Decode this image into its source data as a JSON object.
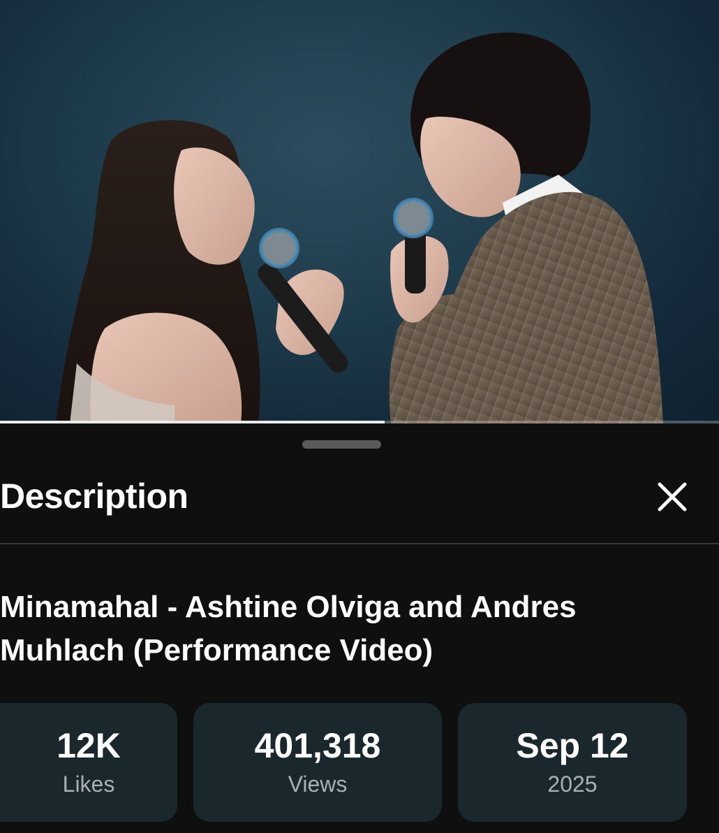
{
  "player": {
    "progress_fraction": 0.535
  },
  "description_panel": {
    "heading": "Description",
    "close_icon": "close-icon"
  },
  "video": {
    "title": "Minamahal - Ashtine Olviga and Andres Muhlach (Performance Video)"
  },
  "stats": {
    "likes": {
      "value": "12K",
      "label": "Likes"
    },
    "views": {
      "value": "401,318",
      "label": "Views"
    },
    "date": {
      "value": "Sep 12",
      "label": "2025"
    }
  },
  "colors": {
    "background": "#0f0f0f",
    "stat_card": "#1a272c",
    "stage_backdrop": "#1d3a4a"
  }
}
